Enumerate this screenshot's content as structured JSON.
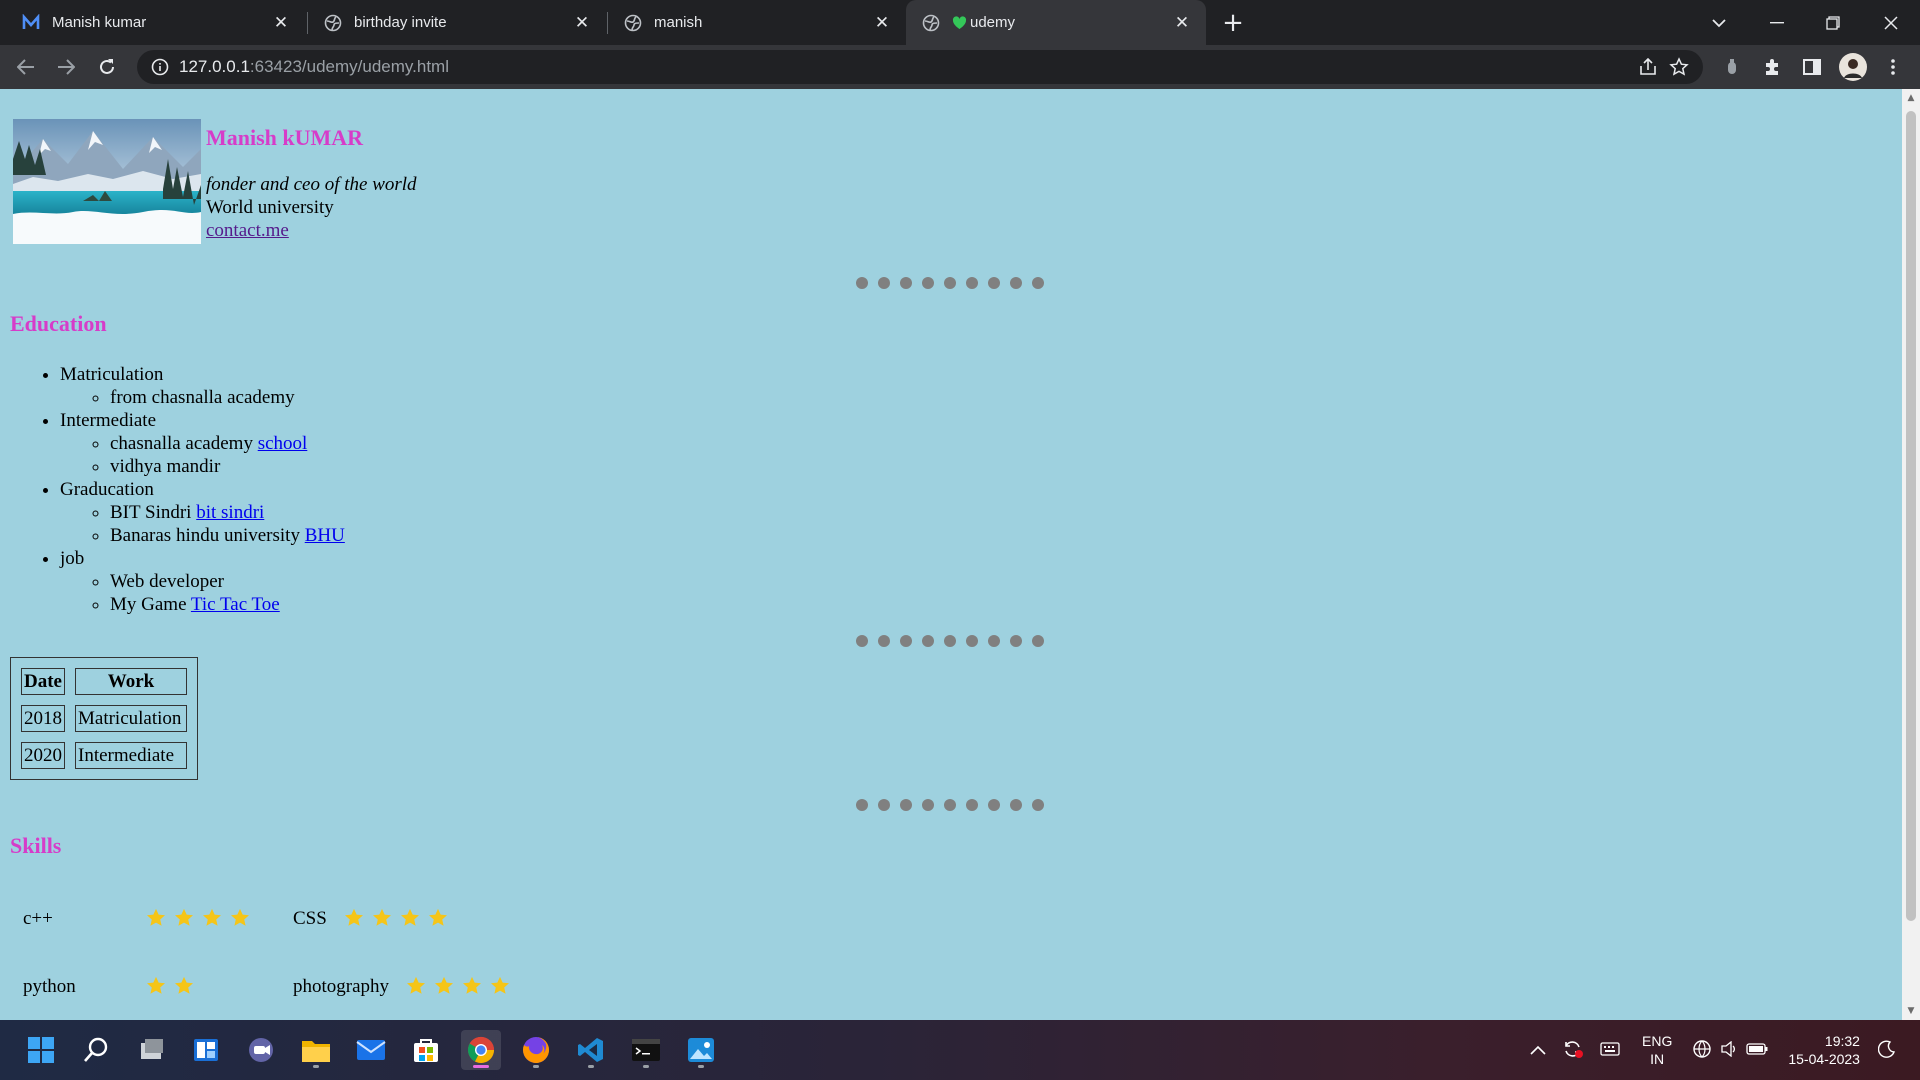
{
  "browser": {
    "tabs": [
      {
        "label": "Manish kumar",
        "icon": "m-logo-icon",
        "active": false
      },
      {
        "label": "birthday invite",
        "icon": "globe-icon",
        "active": false
      },
      {
        "label": "manish",
        "icon": "globe-icon",
        "active": false
      },
      {
        "label": "udemy",
        "icon": "globe-icon",
        "active": true
      }
    ],
    "url_host": "127.0.0.1",
    "url_rest": ":63423/udemy/udemy.html"
  },
  "profile": {
    "name": "Manish kUMAR",
    "tagline": "fonder and ceo of the world",
    "university": "World university",
    "contact": "contact.me"
  },
  "education": {
    "heading": "Education",
    "items": [
      {
        "label": "Matriculation",
        "sub": [
          {
            "text": "from chasnalla academy",
            "link": ""
          }
        ]
      },
      {
        "label": "Intermediate",
        "sub": [
          {
            "text": "chasnalla academy ",
            "link": "school"
          },
          {
            "text": "vidhya mandir",
            "link": ""
          }
        ]
      },
      {
        "label": "Graducation",
        "sub": [
          {
            "text": "BIT Sindri ",
            "link": "bit sindri"
          },
          {
            "text": "Banaras hindu university ",
            "link": "BHU"
          }
        ]
      },
      {
        "label": "job",
        "sub": [
          {
            "text": "Web developer",
            "link": ""
          },
          {
            "text": "My Game ",
            "link": "Tic Tac Toe"
          }
        ]
      }
    ]
  },
  "table": {
    "headers": [
      "Date",
      "Work"
    ],
    "rows": [
      [
        "2018",
        "Matriculation"
      ],
      [
        "2020",
        "Intermediate"
      ]
    ]
  },
  "skills": {
    "heading": "Skills",
    "rows": [
      [
        {
          "name": "c++",
          "stars": 4
        },
        {
          "name": "CSS",
          "stars": 4
        }
      ],
      [
        {
          "name": "python",
          "stars": 2
        },
        {
          "name": "photography",
          "stars": 4
        }
      ]
    ]
  },
  "taskbar": {
    "lang_top": "ENG",
    "lang_bottom": "IN",
    "time": "19:32",
    "date": "15-04-2023"
  },
  "colors": {
    "page_bg": "#9ed1df",
    "heading": "#d63cc9",
    "star": "#f5c518",
    "dot": "#808080"
  }
}
